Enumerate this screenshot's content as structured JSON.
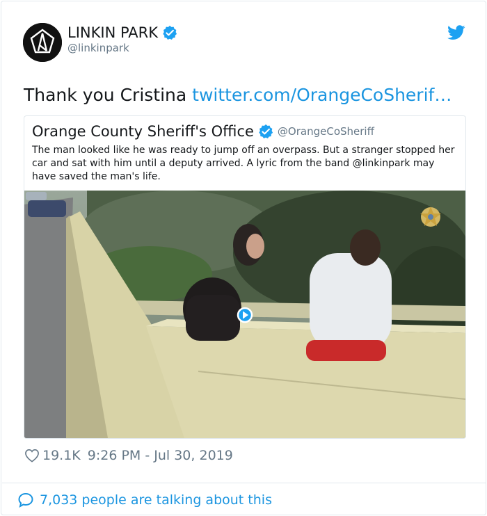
{
  "author": {
    "name": "LINKIN PARK",
    "handle": "@linkinpark"
  },
  "tweet": {
    "text": "Thank you Cristina ",
    "link": "twitter.com/OrangeCoSherif…"
  },
  "quoted": {
    "name": "Orange County Sheriff's Office",
    "handle": "@OrangeCoSheriff",
    "text": "The man looked like he was ready to jump off an overpass. But a stranger stopped her car and sat with him until a deputy arrived. A lyric from the band @linkinpark may have saved the man's life."
  },
  "meta": {
    "likes": "19.1K",
    "timestamp": "9:26 PM - Jul 30, 2019"
  },
  "conversation": {
    "label": "7,033 people are talking about this"
  },
  "colors": {
    "twitter_blue": "#1b95e0",
    "verified_blue": "#1da1f2",
    "gray": "#657786"
  },
  "icons": {
    "verified": "verified-badge-icon",
    "bird": "twitter-bird-icon",
    "heart": "heart-icon",
    "speech": "speech-bubble-icon",
    "play": "play-icon",
    "sheriff_star": "sheriff-star-icon"
  }
}
